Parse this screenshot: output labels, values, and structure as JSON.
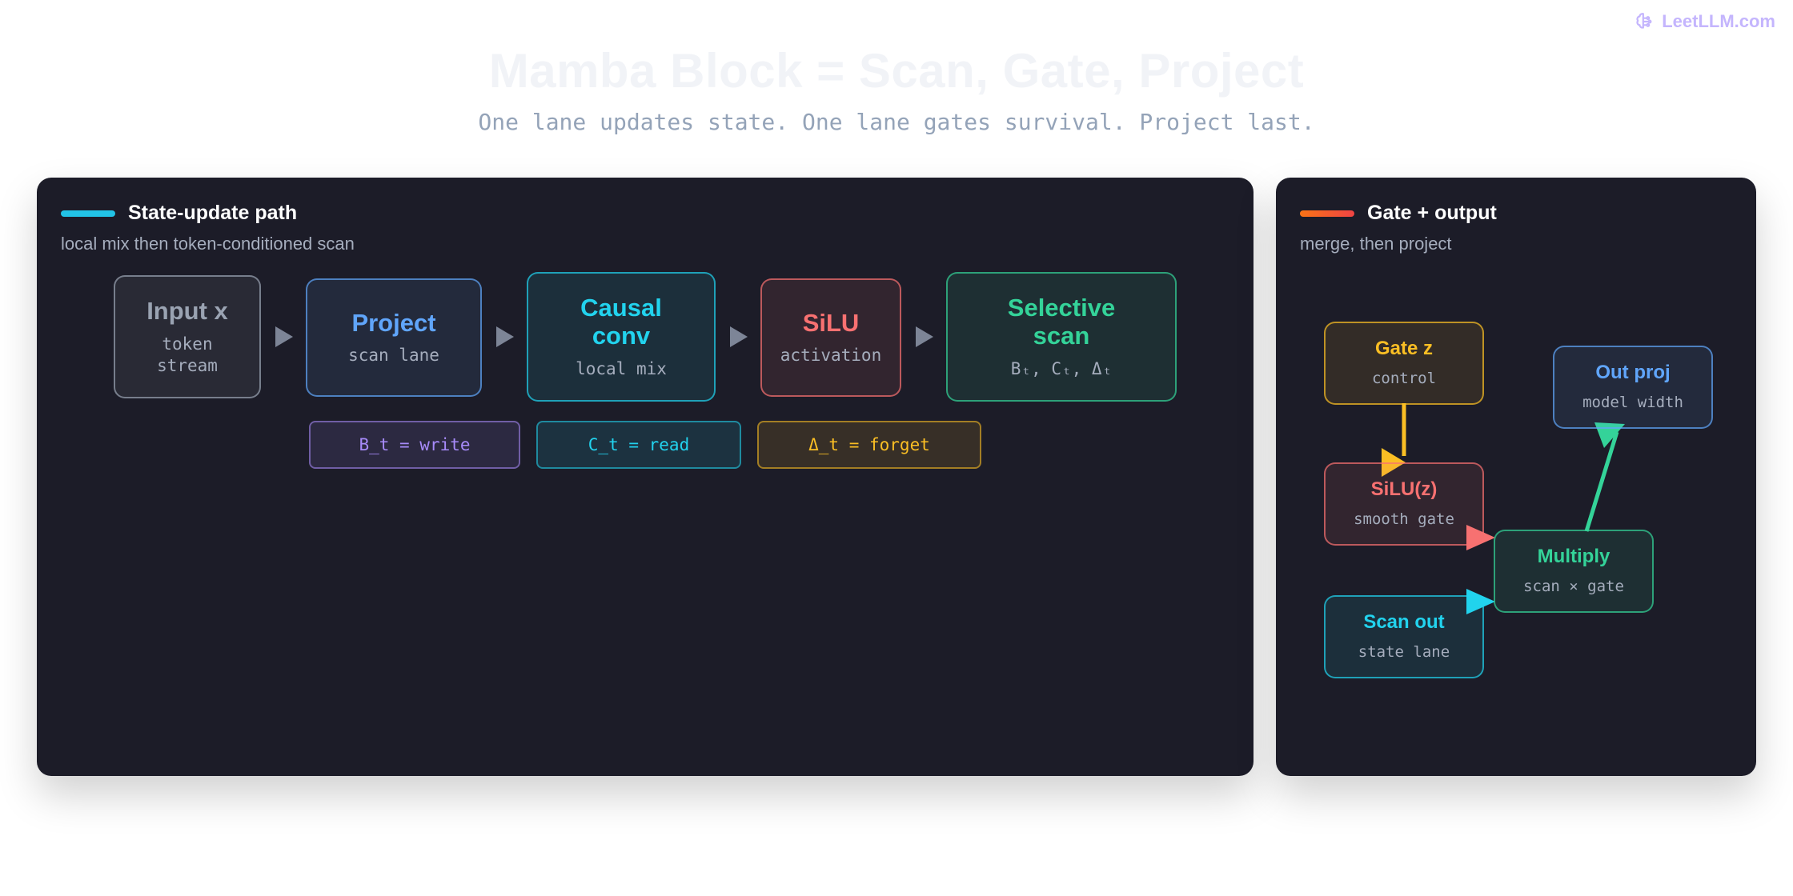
{
  "brand": {
    "label": "LeetLLM.com"
  },
  "title": "Mamba Block = Scan, Gate, Project",
  "subtitle": "One lane updates state. One lane gates survival. Project last.",
  "left_panel": {
    "title": "State-update path",
    "subtitle": "local mix then token-conditioned scan",
    "accent_color": "#22c3e6",
    "nodes": [
      {
        "title": "Input x",
        "sub": "token\nstream",
        "color": "#9aa3b2"
      },
      {
        "title": "Project",
        "sub": "scan lane",
        "color": "#60a5fa"
      },
      {
        "title": "Causal\nconv",
        "sub": "local mix",
        "color": "#22d3ee"
      },
      {
        "title": "SiLU",
        "sub": "activation",
        "color": "#f87171"
      },
      {
        "title": "Selective\nscan",
        "sub": "Bₜ, Cₜ, Δₜ",
        "color": "#34d399"
      }
    ],
    "chips": [
      {
        "label": "B_t = write",
        "color": "#a78bfa"
      },
      {
        "label": "C_t = read",
        "color": "#22d3ee"
      },
      {
        "label": "Δ_t = forget",
        "color": "#fbbf24"
      }
    ]
  },
  "right_panel": {
    "title": "Gate + output",
    "subtitle": "merge, then project",
    "accent_color": "#f97316",
    "nodes": {
      "gate_z": {
        "title": "Gate z",
        "sub": "control",
        "color": "#fbbf24"
      },
      "silu_z": {
        "title": "SiLU(z)",
        "sub": "smooth gate",
        "color": "#f87171"
      },
      "scan_out": {
        "title": "Scan out",
        "sub": "state lane",
        "color": "#22d3ee"
      },
      "multiply": {
        "title": "Multiply",
        "sub": "scan × gate",
        "color": "#34d399"
      },
      "out_proj": {
        "title": "Out proj",
        "sub": "model width",
        "color": "#60a5fa"
      }
    }
  }
}
